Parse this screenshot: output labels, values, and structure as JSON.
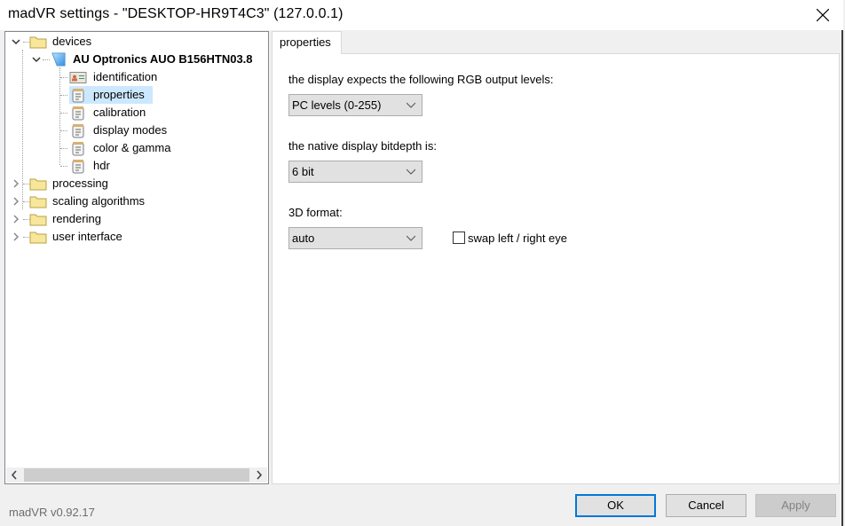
{
  "window": {
    "title": "madVR settings - \"DESKTOP-HR9T4C3\" (127.0.0.1)"
  },
  "tree": {
    "root_items": [
      {
        "label": "devices",
        "expanded": true,
        "icon": "folder-icon"
      },
      {
        "label": "processing",
        "expanded": false,
        "icon": "folder-icon"
      },
      {
        "label": "scaling algorithms",
        "expanded": false,
        "icon": "folder-icon"
      },
      {
        "label": "rendering",
        "expanded": false,
        "icon": "folder-icon"
      },
      {
        "label": "user interface",
        "expanded": false,
        "icon": "folder-icon"
      }
    ],
    "device": {
      "label": "AU Optronics AUO B156HTN03.8",
      "expanded": true,
      "icon": "monitor-icon"
    },
    "device_children": [
      {
        "label": "identification",
        "icon": "id-card-icon",
        "selected": false
      },
      {
        "label": "properties",
        "icon": "page-icon",
        "selected": true
      },
      {
        "label": "calibration",
        "icon": "page-icon",
        "selected": false
      },
      {
        "label": "display modes",
        "icon": "page-icon",
        "selected": false
      },
      {
        "label": "color & gamma",
        "icon": "page-icon",
        "selected": false
      },
      {
        "label": "hdr",
        "icon": "page-icon",
        "selected": false
      }
    ]
  },
  "tabs": [
    {
      "label": "properties",
      "active": true
    }
  ],
  "properties": {
    "rgb_levels_label": "the display expects the following RGB output levels:",
    "rgb_levels_value": "PC levels (0-255)",
    "bitdepth_label": "the native display bitdepth is:",
    "bitdepth_value": "6 bit",
    "format3d_label": "3D format:",
    "format3d_value": "auto",
    "swap_eyes_label": "swap left / right eye",
    "swap_eyes_checked": false
  },
  "footer": {
    "version": "madVR v0.92.17",
    "ok_label": "OK",
    "cancel_label": "Cancel",
    "apply_label": "Apply",
    "apply_enabled": false
  },
  "colors": {
    "selection": "#cce8ff",
    "default_button_border": "#0078d7",
    "folder": "#f8e79a"
  }
}
